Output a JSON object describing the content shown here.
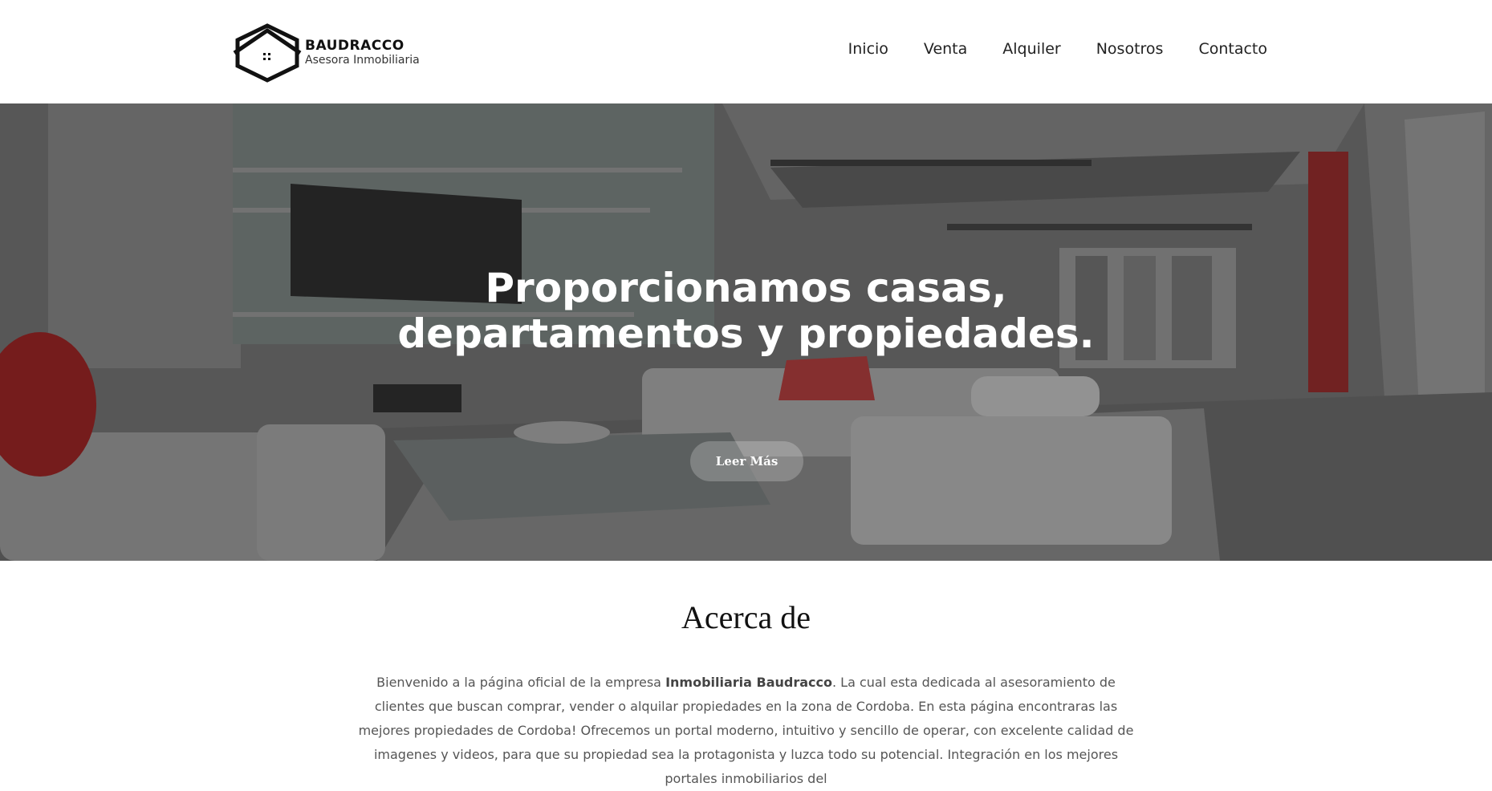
{
  "brand": {
    "name": "BAUDRACCO",
    "tagline": "Asesora Inmobiliaria",
    "logo_icon": "house-hexagon-logo-icon"
  },
  "nav": {
    "items": [
      {
        "label": "Inicio"
      },
      {
        "label": "Venta"
      },
      {
        "label": "Alquiler"
      },
      {
        "label": "Nosotros"
      },
      {
        "label": "Contacto"
      }
    ]
  },
  "hero": {
    "title_line1": "Proporcionamos casas,",
    "title_line2": "departamentos y propiedades.",
    "button_label": "Leer Más"
  },
  "about": {
    "title": "Acerca de",
    "text_intro": "Bienvenido a la página oficial de la empresa ",
    "company_name": "Inmobiliaria Baudracco",
    "text_rest": ". La cual esta dedicada al asesoramiento de clientes que buscan comprar, vender o alquilar propiedades en la zona de Cordoba. En esta página encontraras las mejores propiedades de Cordoba! Ofrecemos un portal moderno, intuitivo y sencillo de operar, con excelente calidad de imagenes y videos, para que su propiedad sea la protagonista y luzca todo su potencial. Integración en los mejores portales inmobiliarios del"
  },
  "colors": {
    "header_bg": "#ffffff",
    "nav_text": "#222222",
    "hero_text": "#ffffff",
    "body_text": "#555555",
    "accent_red": "#c62828"
  }
}
